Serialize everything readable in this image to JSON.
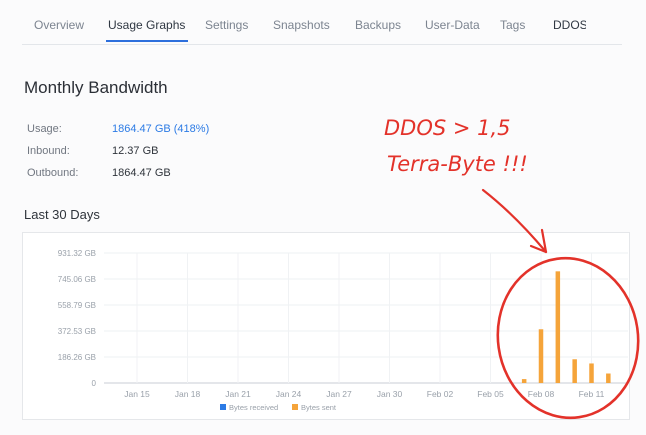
{
  "tabs": [
    {
      "label": "Overview"
    },
    {
      "label": "Usage Graphs"
    },
    {
      "label": "Settings"
    },
    {
      "label": "Snapshots"
    },
    {
      "label": "Backups"
    },
    {
      "label": "User-Data"
    },
    {
      "label": "Tags"
    },
    {
      "label": "DDOS"
    }
  ],
  "active_tab": "Usage Graphs",
  "section_title": "Monthly Bandwidth",
  "stats": {
    "usage_label": "Usage:",
    "usage_value": "1864.47 GB (418%)",
    "inbound_label": "Inbound:",
    "inbound_value": "12.37 GB",
    "outbound_label": "Outbound:",
    "outbound_value": "1864.47 GB"
  },
  "chart_section_title": "Last 30 Days",
  "colors": {
    "accent": "#2d6fdc",
    "bytes_received": "#2c7be5",
    "bytes_sent": "#f5a43a",
    "annotation": "#e3322a"
  },
  "chart_data": {
    "type": "bar",
    "y_ticks": [
      "931.32 GB",
      "745.06 GB",
      "558.79 GB",
      "372.53 GB",
      "186.26 GB",
      "0"
    ],
    "ylim": [
      0,
      931.32
    ],
    "x_ticks": [
      "Jan 15",
      "Jan 18",
      "Jan 21",
      "Jan 24",
      "Jan 27",
      "Jan 30",
      "Feb 02",
      "Feb 05",
      "Feb 08",
      "Feb 11"
    ],
    "legend": [
      "Bytes received",
      "Bytes sent"
    ],
    "legend_position": "bottom",
    "grid": true,
    "series": [
      {
        "name": "Bytes received",
        "values": []
      },
      {
        "name": "Bytes sent",
        "points": [
          {
            "x": "Feb 07",
            "y": 28
          },
          {
            "x": "Feb 08",
            "y": 385
          },
          {
            "x": "Feb 09",
            "y": 800
          },
          {
            "x": "Feb 10",
            "y": 170
          },
          {
            "x": "Feb 11",
            "y": 140
          },
          {
            "x": "Feb 12",
            "y": 68
          }
        ]
      }
    ]
  },
  "annotation": {
    "line1": "DDOS > 1,5",
    "line2": "Terra-Byte !!!"
  }
}
